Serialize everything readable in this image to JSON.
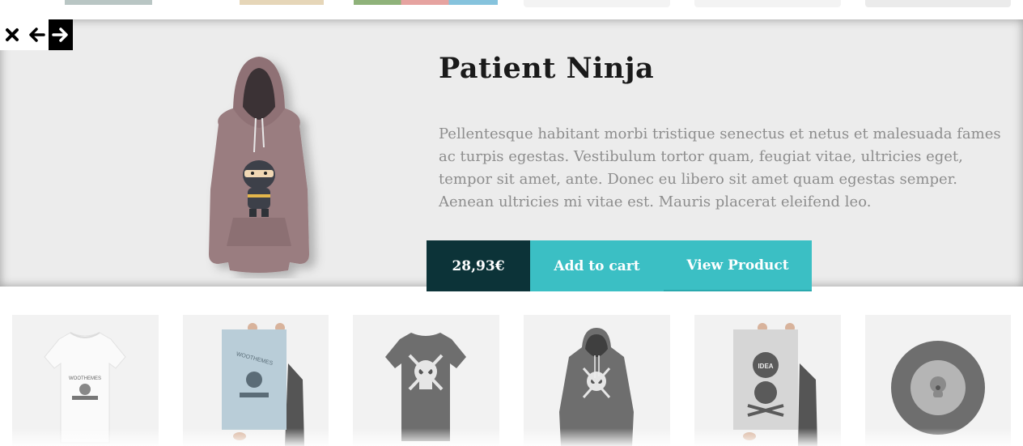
{
  "quickview": {
    "title": "Patient Ninja",
    "description": "Pellentesque habitant morbi tristique senectus et netus et malesuada fames ac turpis egestas. Vestibulum tortor quam, feugiat vitae, ultricies eget, tempor sit amet, ante. Donec eu libero sit amet quam egestas semper. Aenean ultricies mi vitae est. Mauris placerat eleifend leo.",
    "price": "28,93€",
    "add_to_cart_label": "Add to cart",
    "view_product_label": "View Product",
    "close_icon": "close-icon",
    "prev_icon": "arrow-left-icon",
    "next_icon": "arrow-right-icon"
  },
  "products": [
    {
      "image": "woothemes-white-tshirt"
    },
    {
      "image": "woothemes-poster"
    },
    {
      "image": "skull-grey-tshirt"
    },
    {
      "image": "skull-grey-hoodie"
    },
    {
      "image": "ship-your-idea-poster"
    },
    {
      "image": "vinyl-record"
    }
  ],
  "colors": {
    "accent": "#3bbfc4",
    "price_bg": "#0c3338",
    "panel_bg": "#ececec",
    "title": "#1a1a1a",
    "desc": "#8d8d8d"
  }
}
